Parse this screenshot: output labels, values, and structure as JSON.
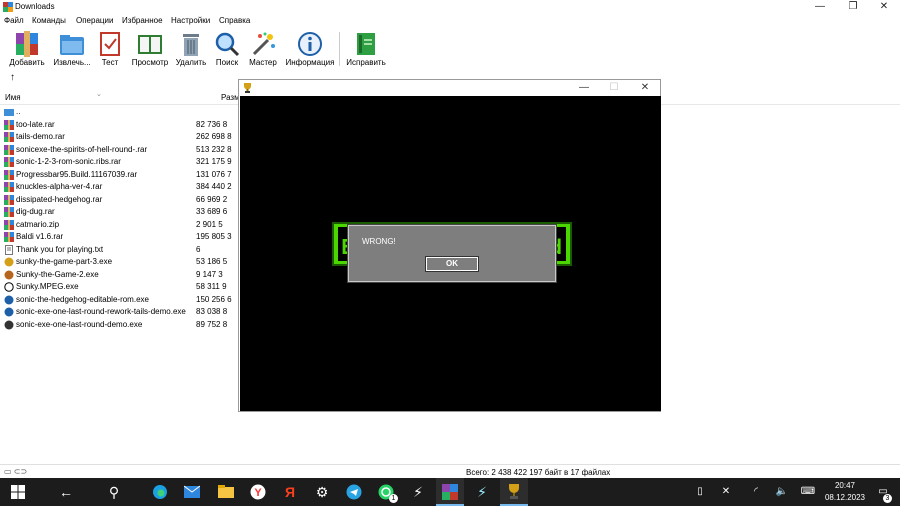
{
  "window": {
    "title": "Downloads",
    "controls": {
      "minimize": "—",
      "restore": "❐",
      "close": "✕"
    }
  },
  "menu": [
    {
      "label": "Файл",
      "accel": "Ф"
    },
    {
      "label": "Команды",
      "accel": "К"
    },
    {
      "label": "Операции",
      "accel": "О"
    },
    {
      "label": "Избранное",
      "accel": "И"
    },
    {
      "label": "Настройки",
      "accel": "Н"
    },
    {
      "label": "Справка",
      "accel": "С"
    }
  ],
  "toolbar": [
    {
      "label": "Добавить",
      "icon": "add-archive-icon"
    },
    {
      "label": "Извлечь...",
      "icon": "extract-folder-icon"
    },
    {
      "label": "Тест",
      "icon": "test-clipboard-icon"
    },
    {
      "label": "Просмотр",
      "icon": "view-book-icon"
    },
    {
      "label": "Удалить",
      "icon": "trash-icon"
    },
    {
      "label": "Поиск",
      "icon": "magnifier-icon"
    },
    {
      "label": "Мастер",
      "icon": "wizard-wand-icon"
    },
    {
      "label": "Информация",
      "icon": "info-icon"
    },
    {
      "label": "Исправить",
      "icon": "repair-book-icon"
    }
  ],
  "list_header": {
    "name": "Имя",
    "size": "Размер"
  },
  "files": [
    {
      "name": "..",
      "size": "",
      "icon": "folder-up-icon"
    },
    {
      "name": "too-late.rar",
      "size": "82 736 8",
      "icon": "rar-icon"
    },
    {
      "name": "tails-demo.rar",
      "size": "262 698 8",
      "icon": "rar-icon"
    },
    {
      "name": "sonicexe-the-spirits-of-hell-round-.rar",
      "size": "513 232 8",
      "icon": "rar-icon"
    },
    {
      "name": "sonic-1-2-3-rom-sonic.ribs.rar",
      "size": "321 175 9",
      "icon": "rar-icon"
    },
    {
      "name": "Progressbar95.Build.11167039.rar",
      "size": "131 076 7",
      "icon": "rar-icon"
    },
    {
      "name": "knuckles-alpha-ver-4.rar",
      "size": "384 440 2",
      "icon": "rar-icon"
    },
    {
      "name": "dissipated-hedgehog.rar",
      "size": "66 969 2",
      "icon": "rar-icon"
    },
    {
      "name": "dig-dug.rar",
      "size": "33 689 6",
      "icon": "rar-icon"
    },
    {
      "name": "catmario.zip",
      "size": "2 901 5",
      "icon": "zip-icon"
    },
    {
      "name": "Baldi v1.6.rar",
      "size": "195 805 3",
      "icon": "rar-icon"
    },
    {
      "name": "Thank you for playing.txt",
      "size": "6",
      "icon": "text-file-icon"
    },
    {
      "name": "sunky-the-game-part-3.exe",
      "size": "53 186 5",
      "icon": "trophy-exe-icon"
    },
    {
      "name": "Sunky-the-Game-2.exe",
      "size": "9 147 3",
      "icon": "sunky-face-icon"
    },
    {
      "name": "Sunky.MPEG.exe",
      "size": "58 311 9",
      "icon": "circle-exe-icon"
    },
    {
      "name": "sonic-the-hedgehog-editable-rom.exe",
      "size": "150 256 6",
      "icon": "sonic-exe-icon"
    },
    {
      "name": "sonic-exe-one-last-round-rework-tails-demo.exe",
      "size": "83 038 8",
      "icon": "sonic-exe-icon"
    },
    {
      "name": "sonic-exe-one-last-round-demo.exe",
      "size": "89 752 8",
      "icon": "sonic-dark-icon"
    }
  ],
  "status": {
    "text": "Всего: 2 438 422 197 байт в 17 файлах"
  },
  "game_window": {
    "controls": {
      "minimize": "—",
      "maximize": "☐",
      "close": "✕"
    },
    "green_left": "E",
    "green_right": "d",
    "dialog_message": "WRONG!",
    "ok_label": "OK"
  },
  "taskbar": {
    "time": "20:47",
    "date": "08.12.2023",
    "notification_count": "3",
    "telegram_badge": "1",
    "apps": [
      "windows-start-icon",
      "back-arrow-icon",
      "search-icon",
      "edge-icon",
      "mail-icon",
      "file-explorer-icon",
      "yandex-browser-icon",
      "yandex-icon",
      "settings-gear-icon",
      "telegram-icon",
      "whatsapp-icon",
      "lightning-app-icon",
      "winrar-icon",
      "lightning-app-2-icon",
      "trophy-game-icon"
    ]
  },
  "colors": {
    "game_green": "#4bd600",
    "dialog_gray": "#7e7e7e",
    "taskbar": "#1c1c1c"
  }
}
